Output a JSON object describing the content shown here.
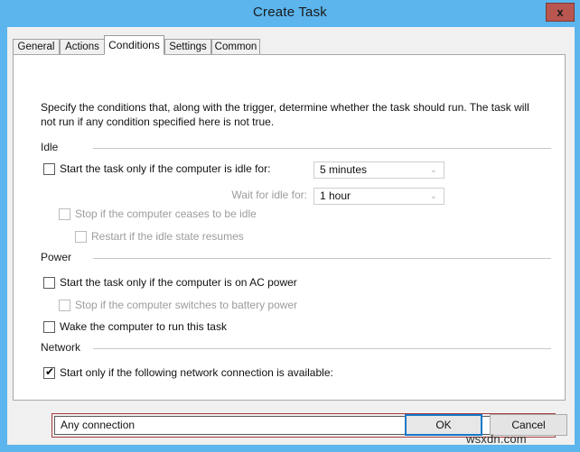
{
  "window": {
    "title": "Create Task",
    "close_label": "x",
    "titlebar_color": "#5cb5ed",
    "close_color": "#b9564f"
  },
  "tabs": [
    {
      "label": "General",
      "selected": false
    },
    {
      "label": "Actions",
      "selected": false
    },
    {
      "label": "Conditions",
      "selected": true
    },
    {
      "label": "Settings",
      "selected": false
    },
    {
      "label": "Common",
      "selected": false
    }
  ],
  "page": {
    "description": "Specify the conditions that, along with the trigger, determine whether the task should run. The task will not run if any condition specified here is not true.",
    "groups": {
      "idle": "Idle",
      "power": "Power",
      "network": "Network"
    },
    "idle": {
      "start_if_idle": {
        "label": "Start the task only if the computer is idle for:",
        "checked": false,
        "enabled": true
      },
      "idle_duration": {
        "value": "5 minutes",
        "enabled": false
      },
      "wait_for_idle_label": "Wait for idle for:",
      "wait_duration": {
        "value": "1 hour",
        "enabled": false
      },
      "stop_if_ceases": {
        "label": "Stop if the computer ceases to be idle",
        "checked": false,
        "enabled": false
      },
      "restart_if_resumes": {
        "label": "Restart if the idle state resumes",
        "checked": false,
        "enabled": false
      }
    },
    "power": {
      "start_if_ac": {
        "label": "Start the task only if the computer is on AC power",
        "checked": false,
        "enabled": true
      },
      "stop_if_battery": {
        "label": "Stop if the computer switches to battery power",
        "checked": false,
        "enabled": false
      },
      "wake_computer": {
        "label": "Wake the computer to run this task",
        "checked": false,
        "enabled": true
      }
    },
    "network": {
      "start_if_network": {
        "label": "Start only if the following network connection is available:",
        "checked": true,
        "enabled": true
      },
      "connection": {
        "value": "Any connection",
        "enabled": true
      },
      "highlight_color": "#a83c3c"
    }
  },
  "footer": {
    "ok_label": "OK",
    "cancel_label": "Cancel"
  },
  "watermark": "wsxdn.com",
  "icons": {
    "checkmark": "✔",
    "chevron_down": "⌄"
  }
}
